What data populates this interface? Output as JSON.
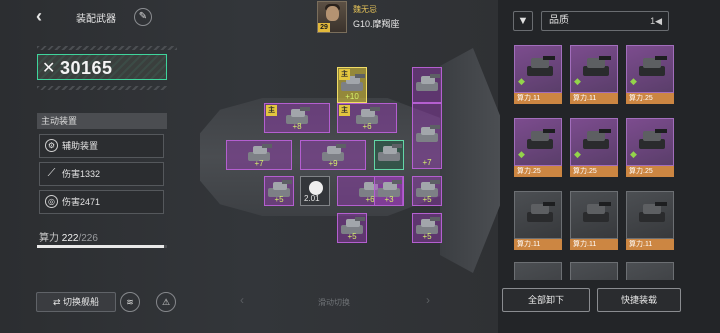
{
  "header": {
    "title": "装配武器",
    "back_icon": "back-arrow-icon",
    "edit_icon": "edit-icon"
  },
  "pilot": {
    "name": "魏无忌",
    "level": "29",
    "ship": "G10.摩羯座"
  },
  "power": {
    "icon": "✕",
    "value": "30165"
  },
  "active_equipment": {
    "header": "主动装置",
    "items": [
      {
        "icon": "gear-icon",
        "glyph": "⚙",
        "label": "辅助装置"
      },
      {
        "icon": "slash-icon",
        "glyph": "⟋",
        "label": "伤害1332"
      },
      {
        "icon": "target-icon",
        "glyph": "◎",
        "label": "伤害2471"
      }
    ]
  },
  "assembly_points": {
    "label": "算力",
    "current": "222",
    "total": "/226",
    "fill": 0.98
  },
  "bottom": {
    "switch_ship": "⇄ 切换舰船",
    "slide_hint": "滑动切换",
    "btn1_glyph": "≋",
    "btn2_glyph": "⚠"
  },
  "slots": [
    {
      "id": "s1",
      "plus": "+10",
      "badge": "主",
      "variant": "yellow"
    },
    {
      "id": "s2",
      "plus": "",
      "badge": "",
      "variant": "purple"
    },
    {
      "id": "s3",
      "plus": "+8",
      "badge": "主",
      "variant": "purple"
    },
    {
      "id": "s4",
      "plus": "+6",
      "badge": "主",
      "variant": "purple"
    },
    {
      "id": "s5",
      "plus": "+7",
      "badge": "",
      "variant": "purple"
    },
    {
      "id": "s6",
      "plus": "+7",
      "badge": "",
      "variant": "purple"
    },
    {
      "id": "s7",
      "plus": "+9",
      "badge": "",
      "variant": "purple"
    },
    {
      "id": "s8",
      "plus": "",
      "badge": "",
      "variant": "green"
    },
    {
      "id": "s9",
      "plus": "+5",
      "badge": "",
      "variant": "purple"
    },
    {
      "id": "s10",
      "plus": "+5",
      "badge": "",
      "variant": "purple"
    },
    {
      "id": "s11",
      "plus": "",
      "badge": "",
      "variant": "dark",
      "lv": "2.01"
    },
    {
      "id": "s12",
      "plus": "+6",
      "badge": "",
      "variant": "purple"
    },
    {
      "id": "s13",
      "plus": "+5",
      "badge": "",
      "variant": "purple"
    },
    {
      "id": "s14",
      "plus": "+5",
      "badge": "",
      "variant": "purple"
    },
    {
      "id": "s15",
      "plus": "+3",
      "badge": "",
      "variant": "purple"
    }
  ],
  "inventory": {
    "filter_icon": "filter-icon",
    "quality_label": "品质",
    "sort_glyph": "1◀",
    "cards": [
      {
        "label": "算力.11",
        "variant": "purple"
      },
      {
        "label": "算力.11",
        "variant": "purple"
      },
      {
        "label": "算力.25",
        "variant": "purple"
      },
      {
        "label": "算力.25",
        "variant": "purple"
      },
      {
        "label": "算力.25",
        "variant": "purple"
      },
      {
        "label": "算力.25",
        "variant": "purple"
      },
      {
        "label": "算力.11",
        "variant": "gray"
      },
      {
        "label": "算力.11",
        "variant": "gray"
      },
      {
        "label": "算力.11",
        "variant": "gray"
      }
    ],
    "unload_all": "全部卸下",
    "quick_equip": "快捷装载"
  }
}
